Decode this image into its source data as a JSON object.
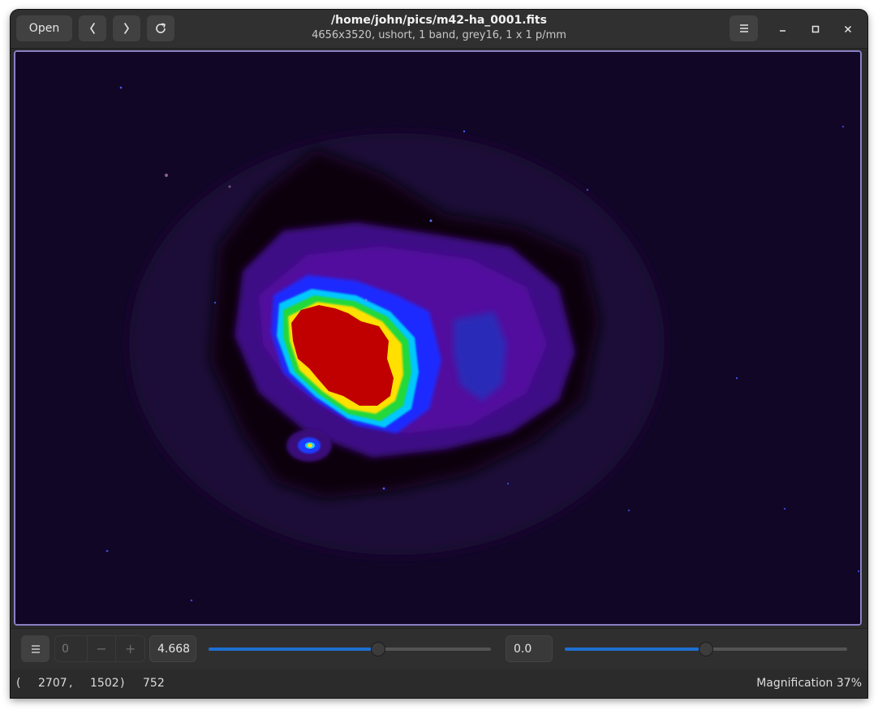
{
  "header": {
    "open_label": "Open",
    "prev_icon": "chevron-left-icon",
    "next_icon": "chevron-right-icon",
    "reload_icon": "reload-icon",
    "title": "/home/john/pics/m42-ha_0001.fits",
    "subtitle": "4656x3520,  ushort, 1 band, grey16, 1 x 1 p/mm",
    "menu_icon": "hamburger-menu-icon"
  },
  "window_controls": [
    "minimize-icon",
    "maximize-icon",
    "close-icon"
  ],
  "image": {
    "description_colors": [
      "#120626",
      "#3a0a7a",
      "#1a3cff",
      "#00e0ff",
      "#20e040",
      "#ffe000",
      "#c00000"
    ]
  },
  "toolbar": {
    "menu_icon": "hamburger-menu-icon",
    "page_value": "0",
    "minus_label": "−",
    "plus_label": "+",
    "scale_value": "4.668",
    "scale_slider_fraction": 0.6,
    "offset_value": "0.0",
    "offset_slider_fraction": 0.5,
    "accent": "#1e6fd0"
  },
  "status": {
    "open_paren": "(",
    "x": "2707",
    "comma": ",",
    "y": "1502",
    "close_paren": ")",
    "pixel_value": "752",
    "magnification": "Magnification 37%"
  }
}
